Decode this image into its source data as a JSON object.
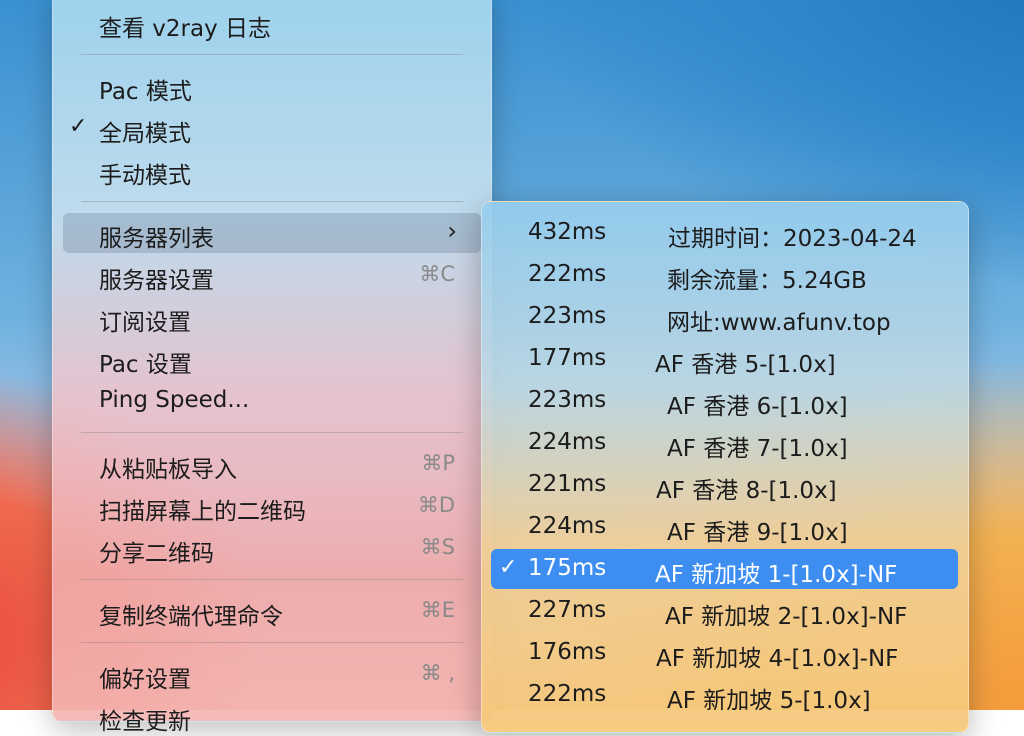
{
  "main_menu": {
    "view_log": "查看 v2ray 日志",
    "pac_mode": "Pac 模式",
    "global_mode": "全局模式",
    "global_mode_check": "✓",
    "manual_mode": "手动模式",
    "server_list": "服务器列表",
    "server_list_arrow": "›",
    "server_settings": "服务器设置",
    "server_settings_sc": "⌘C",
    "subscription_settings": "订阅设置",
    "pac_settings": "Pac 设置",
    "ping_speed": "Ping Speed...",
    "import_clipboard": "从粘贴板导入",
    "import_clipboard_sc": "⌘P",
    "scan_qr": "扫描屏幕上的二维码",
    "scan_qr_sc": "⌘D",
    "share_qr": "分享二维码",
    "share_qr_sc": "⌘S",
    "copy_terminal": "复制终端代理命令",
    "copy_terminal_sc": "⌘E",
    "preferences": "偏好设置",
    "preferences_sc": "⌘ ,",
    "check_updates": "检查更新"
  },
  "server_list": {
    "items": [
      {
        "ms": "432ms",
        "name": "过期时间：2023-04-24"
      },
      {
        "ms": "222ms",
        "name": "剩余流量：5.24GB"
      },
      {
        "ms": "223ms",
        "name": "网址:www.afunv.top"
      },
      {
        "ms": "177ms",
        "name": "AF 香港 5-[1.0x]"
      },
      {
        "ms": "223ms",
        "name": "AF 香港 6-[1.0x]"
      },
      {
        "ms": "224ms",
        "name": "AF 香港 7-[1.0x]"
      },
      {
        "ms": "221ms",
        "name": "AF 香港 8-[1.0x]"
      },
      {
        "ms": "224ms",
        "name": "AF 香港 9-[1.0x]"
      },
      {
        "ms": "175ms",
        "name": "AF 新加坡 1-[1.0x]-NF",
        "check": "✓"
      },
      {
        "ms": "227ms",
        "name": "AF 新加坡 2-[1.0x]-NF"
      },
      {
        "ms": "176ms",
        "name": "AF 新加坡 4-[1.0x]-NF"
      },
      {
        "ms": "222ms",
        "name": "AF 新加坡 5-[1.0x]"
      }
    ]
  }
}
